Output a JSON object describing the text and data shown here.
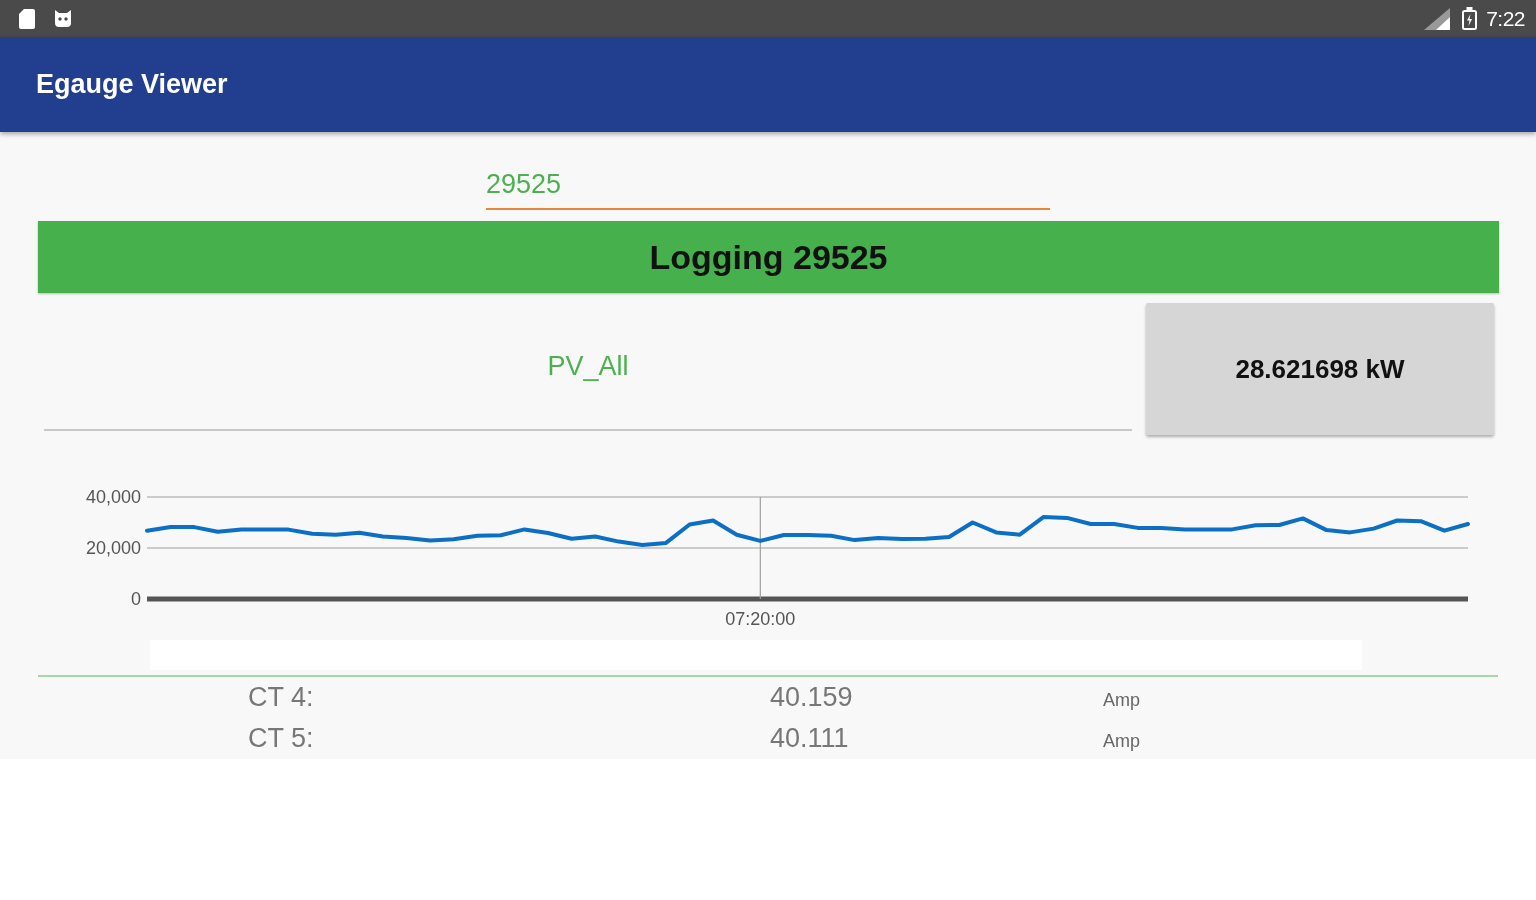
{
  "status_bar": {
    "time": "7:22"
  },
  "app_bar": {
    "title": "Egauge Viewer"
  },
  "device_field": {
    "value": "29525"
  },
  "logging_banner": {
    "text": "Logging 29525"
  },
  "channel": {
    "name": "PV_All",
    "reading": "28.621698 kW"
  },
  "graph": {
    "chart_data": {
      "type": "line",
      "color": "#0b6fc6",
      "grid": true,
      "ylim": [
        0,
        40000
      ],
      "yticks": [
        {
          "value": 0,
          "label": "0"
        },
        {
          "value": 20000,
          "label": "20,000"
        },
        {
          "value": 40000,
          "label": "40,000"
        }
      ],
      "categories": [
        null,
        null,
        null,
        null,
        null,
        null,
        null,
        null,
        null,
        null,
        null,
        null,
        null,
        null,
        null,
        null,
        null,
        null,
        null,
        null,
        null,
        null,
        null,
        null,
        null,
        null,
        "07:20:00",
        null,
        null,
        null,
        null,
        null,
        null,
        null,
        null,
        null,
        null,
        null,
        null,
        null,
        null,
        null,
        null,
        null,
        null,
        null,
        null,
        null,
        null,
        null,
        null,
        null,
        null,
        null,
        null,
        null,
        null
      ],
      "values": [
        26800,
        28200,
        28200,
        26400,
        27200,
        27300,
        27200,
        25600,
        25200,
        26000,
        24500,
        23900,
        23000,
        23400,
        24800,
        25000,
        27300,
        25900,
        23600,
        24500,
        22500,
        21200,
        22000,
        29200,
        30800,
        25200,
        22800,
        25100,
        25100,
        24800,
        23100,
        23900,
        23500,
        23600,
        24300,
        30000,
        26100,
        25200,
        32100,
        31800,
        29400,
        29400,
        27900,
        27800,
        27300,
        27300,
        27300,
        28900,
        29000,
        31600,
        27000,
        26100,
        27600,
        30800,
        30500,
        26800,
        29400
      ]
    }
  },
  "readings": [
    {
      "label": "CT 4:",
      "value": "40.159",
      "unit": "Amp"
    },
    {
      "label": "CT 5:",
      "value": "40.111",
      "unit": "Amp"
    }
  ]
}
